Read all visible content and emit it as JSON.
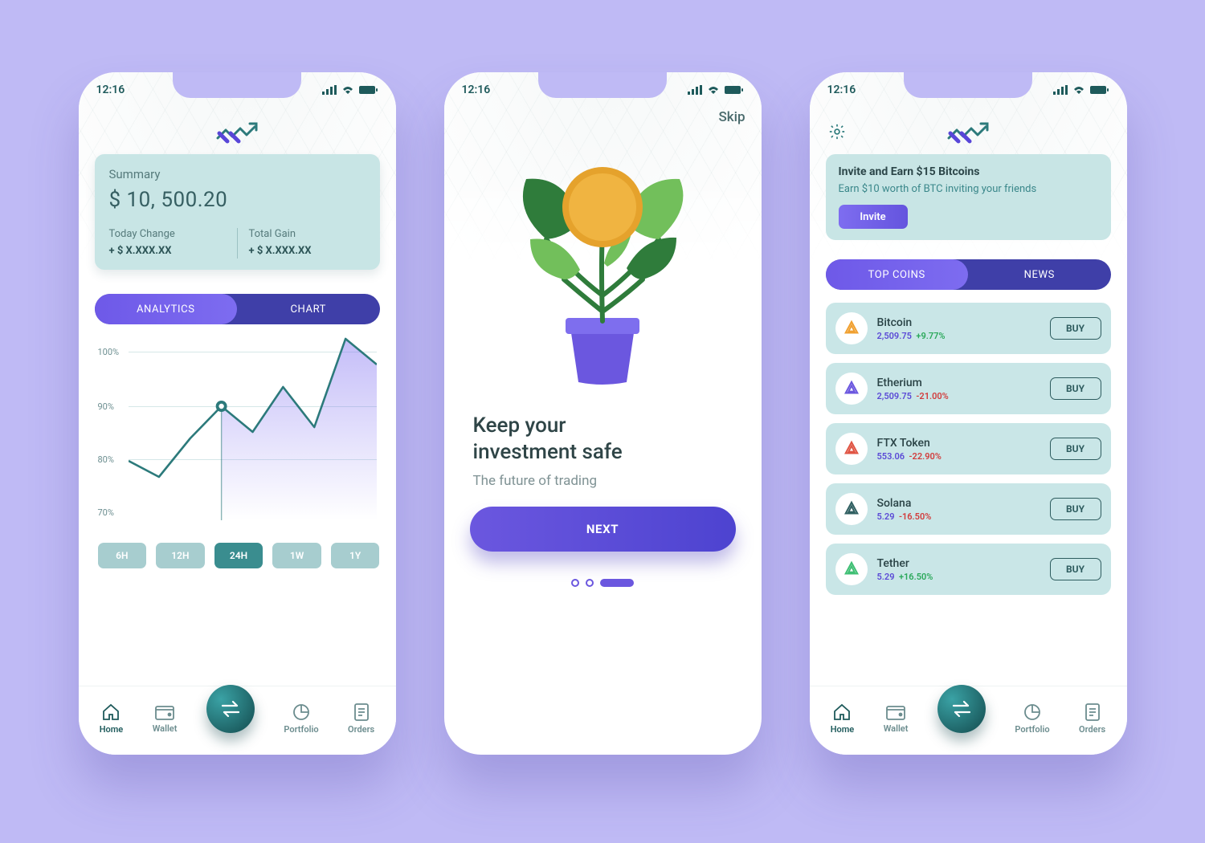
{
  "status_time": "12:16",
  "colors": {
    "accent": "#6b57df",
    "teal": "#2c7a7b",
    "mint": "#c8e5e5",
    "green": "#2aa85a",
    "red": "#d23b3b",
    "bg": "#bfbaf5"
  },
  "nav": {
    "items": [
      {
        "label": "Home"
      },
      {
        "label": "Wallet"
      },
      {
        "label": "Portfolio"
      },
      {
        "label": "Orders"
      }
    ],
    "active_index": 0
  },
  "screen1": {
    "summary": {
      "label": "Summary",
      "amount": "$ 10, 500.20",
      "today_change_label": "Today Change",
      "today_change": "+ $ X.XXX.XX",
      "total_gain_label": "Total Gain",
      "total_gain": "+ $ X.XXX.XX"
    },
    "tabs": {
      "analytics": "ANALYTICS",
      "chart": "CHART",
      "active": "analytics"
    },
    "ranges": [
      "6H",
      "12H",
      "24H",
      "1W",
      "1Y"
    ],
    "active_range": "24H"
  },
  "screen2": {
    "skip": "Skip",
    "title_line1": "Keep your",
    "title_line2": "investment safe",
    "subtitle": "The future of trading",
    "cta": "NEXT",
    "page_count": 3,
    "page_index": 2
  },
  "screen3": {
    "invite": {
      "title": "Invite and Earn $15 Bitcoins",
      "subtitle": "Earn $10 worth of BTC inviting your friends",
      "button": "Invite"
    },
    "tabs": {
      "top": "TOP COINS",
      "news": "NEWS",
      "active": "top"
    },
    "buy_label": "BUY",
    "coins": [
      {
        "name": "Bitcoin",
        "price": "2,509.75",
        "delta": "+9.77%",
        "delta_positive": true,
        "icon_color": "#f0a030"
      },
      {
        "name": "Etherium",
        "price": "2,509.75",
        "delta": "-21.00%",
        "delta_positive": false,
        "icon_color": "#6b57df"
      },
      {
        "name": "FTX Token",
        "price": "553.06",
        "delta": "-22.90%",
        "delta_positive": false,
        "icon_color": "#e05544"
      },
      {
        "name": "Solana",
        "price": "5.29",
        "delta": "-16.50%",
        "delta_positive": false,
        "icon_color": "#305f61"
      },
      {
        "name": "Tether",
        "price": "5.29",
        "delta": "+16.50%",
        "delta_positive": true,
        "icon_color": "#3fbf74"
      }
    ]
  },
  "chart_data": {
    "type": "line",
    "x_ticks": [
      "70%",
      "80%",
      "90%",
      "100%"
    ],
    "ylim": [
      68,
      104
    ],
    "xlabel": "",
    "ylabel": "",
    "highlight": {
      "i": 3,
      "value": 90
    },
    "values": [
      78,
      75,
      82,
      90,
      84,
      92,
      86,
      103,
      98
    ]
  }
}
